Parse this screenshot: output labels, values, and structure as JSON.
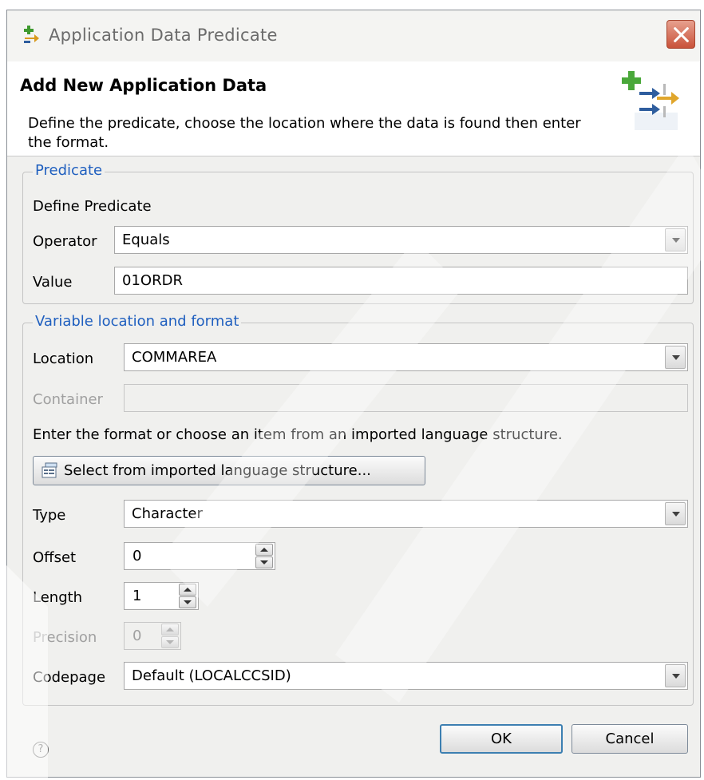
{
  "window": {
    "title": "Application Data Predicate",
    "close_label": "Close"
  },
  "banner": {
    "title": "Add New Application Data",
    "description": "Define the predicate, choose the location where the data is found then enter the format."
  },
  "predicate": {
    "legend": "Predicate",
    "heading": "Define Predicate",
    "operator_label": "Operator",
    "operator_value": "Equals",
    "value_label": "Value",
    "value_value": "01ORDR"
  },
  "location_group": {
    "legend": "Variable location and format",
    "location_label": "Location",
    "location_value": "COMMAREA",
    "container_label": "Container",
    "container_value": "",
    "instructions": "Enter the format or choose an item from an imported language structure.",
    "select_button_label": "Select from imported language structure...",
    "type_label": "Type",
    "type_value": "Character",
    "offset_label": "Offset",
    "offset_value": "0",
    "length_label": "Length",
    "length_value": "1",
    "precision_label": "Precision",
    "precision_value": "0",
    "codepage_label": "Codepage",
    "codepage_value": "Default (LOCALCCSID)"
  },
  "footer": {
    "help_glyph": "?",
    "ok_label": "OK",
    "cancel_label": "Cancel"
  },
  "icons": {
    "title": "predicate-icon",
    "banner": "add-data-wizard-icon",
    "select_button": "language-structure-icon",
    "help": "help-icon"
  },
  "colors": {
    "legend": "#1f5fbf",
    "dialog_background": "#f0f0ee",
    "default_button_border": "#3c7fb1",
    "close_button": "#c9523a"
  }
}
